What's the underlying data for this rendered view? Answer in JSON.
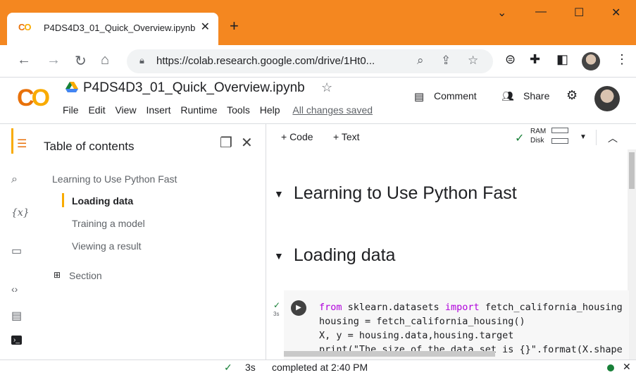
{
  "colors": {
    "tabbar": "#f48720",
    "accent": "#f9ab00",
    "colab_orange": "#e8710a",
    "keyword": "#af00db",
    "ok_green": "#188038"
  },
  "browser": {
    "tab_favicon": "CO",
    "tab_title": "P4DS4D3_01_Quick_Overview.ipynb",
    "url": "https://colab.research.google.com/drive/1Ht0..."
  },
  "colab": {
    "logo": "CO",
    "notebook_title": "P4DS4D3_01_Quick_Overview.ipynb",
    "menu": [
      "File",
      "Edit",
      "View",
      "Insert",
      "Runtime",
      "Tools",
      "Help"
    ],
    "saved_status": "All changes saved",
    "comment_label": "Comment",
    "share_label": "Share"
  },
  "toc": {
    "title": "Table of contents",
    "items": [
      {
        "label": "Learning to Use Python Fast",
        "level": 1
      },
      {
        "label": "Loading data",
        "level": 2,
        "active": true
      },
      {
        "label": "Training a model",
        "level": 2
      },
      {
        "label": "Viewing a result",
        "level": 2
      }
    ],
    "add_section_label": "Section"
  },
  "notebook": {
    "add_code_label": "+ Code",
    "add_text_label": "+ Text",
    "ram_label": "RAM",
    "disk_label": "Disk",
    "headings": [
      "Learning to Use Python Fast",
      "Loading data"
    ],
    "cell": {
      "exec_time": "3s",
      "lines": [
        {
          "kw": "from",
          "mid": " sklearn.datasets ",
          "kw2": "import",
          "rest": " fetch_california_housing"
        },
        {
          "kw": "",
          "mid": "housing = fetch_california_housing()",
          "kw2": "",
          "rest": ""
        },
        {
          "kw": "",
          "mid": "X, y = housing.data,housing.target",
          "kw2": "",
          "rest": ""
        },
        {
          "kw": "",
          "mid": "print(\"The size of the data set is {}\".format(X.shape",
          "kw2": "",
          "rest": ""
        }
      ]
    }
  },
  "statusbar": {
    "time": "3s",
    "text": "completed at 2:40 PM"
  },
  "icons": [
    "back-icon",
    "forward-icon",
    "reload-icon",
    "home-icon",
    "lock-icon",
    "zoom-icon",
    "share-page-icon",
    "bookmark-star-icon",
    "extension-icon",
    "puzzle-icon",
    "sidepanel-icon",
    "more-icon",
    "star-icon",
    "comment-icon",
    "people-icon",
    "settings-icon",
    "toc-icon",
    "search-icon",
    "variables-icon",
    "folder-icon",
    "code-snippets-icon",
    "command-palette-icon",
    "terminal-icon",
    "run-icon",
    "check-icon"
  ]
}
